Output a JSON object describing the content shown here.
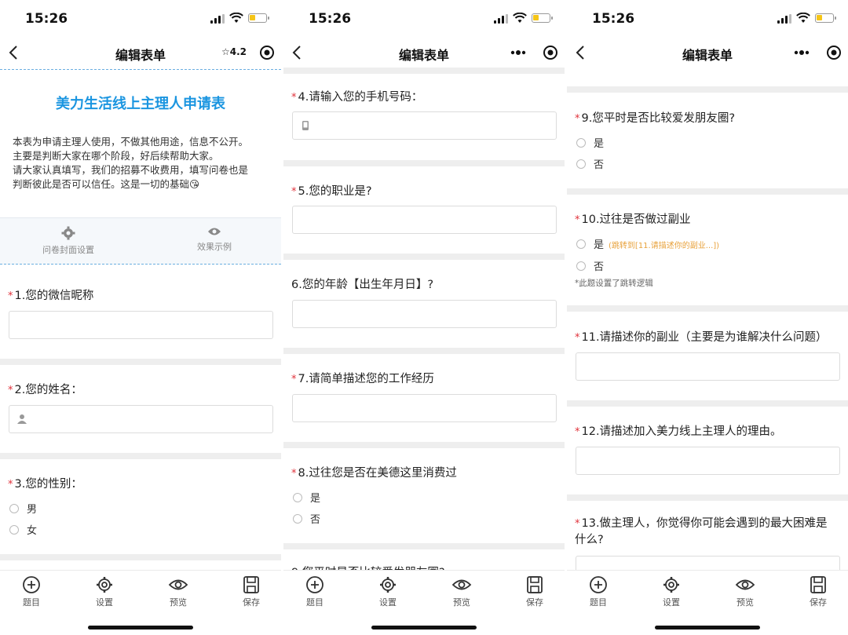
{
  "status": {
    "time": "15:26"
  },
  "nav": {
    "title": "编辑表单",
    "rating": "☆4.2"
  },
  "cover": {
    "title": "美力生活线上主理人申请表",
    "intro": [
      "本表为申请主理人使用，不做其他用途，信息不公开。",
      "主要是判断大家在哪个阶段，好后续帮助大家。",
      "请大家认真填写，我们的招募不收费用，填写问卷也是",
      "判断彼此是否可以信任。这是一切的基础😘"
    ],
    "tools": [
      "问卷封面设置",
      "效果示例"
    ]
  },
  "questions": {
    "q1": "1.您的微信昵称",
    "q2": "2.您的姓名：",
    "q3": "3.您的性别：",
    "q3_options": [
      "男",
      "女"
    ],
    "q4": "4.请输入您的手机号码：",
    "q5": "5.您的职业是?",
    "q6": "6.您的年龄【出生年月日】?",
    "q7": "7.请简单描述您的工作经历",
    "q8": "8.过往您是否在美德这里消费过",
    "q8_options": [
      "是",
      "否"
    ],
    "q9_cut": "9.您平时是否比较爱发朋友圈?",
    "q9": "9.您平时是否比较爱发朋友圈?",
    "q9_options": [
      "是",
      "否"
    ],
    "q10": "10.过往是否做过副业",
    "q10_options": [
      "是",
      "否"
    ],
    "q10_jump": "(跳转到[11.请描述你的副业...])",
    "q10_note": "*此题设置了跳转逻辑",
    "q11": "11.请描述你的副业（主要是为谁解决什么问题）",
    "q12": "12.请描述加入美力线上主理人的理由。",
    "q13_line1": "13.做主理人，你觉得你可能会遇到的最大困难是",
    "q13_line2": "什么?"
  },
  "required_mark": "*",
  "tabbar": [
    "题目",
    "设置",
    "预览",
    "保存"
  ],
  "colors": {
    "accent": "#1a95e0",
    "required": "#e0313a",
    "jump": "#e8a23c"
  }
}
